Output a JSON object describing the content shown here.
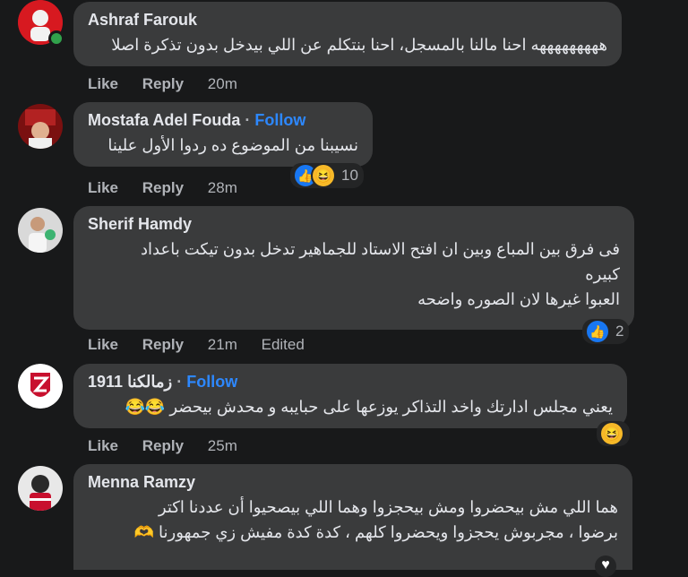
{
  "comments": [
    {
      "name": "Ashraf Farouk",
      "follow": "",
      "text_lines": [
        "هههههههههه احنا مالنا بالمسجل، احنا بنتكلم عن اللي بيدخل بدون تذكرة اصلا"
      ],
      "actions": {
        "like": "Like",
        "reply": "Reply",
        "time": "20m",
        "edited": ""
      },
      "reactions": {
        "count": ""
      }
    },
    {
      "name": "Mostafa Adel Fouda",
      "follow": "Follow",
      "text_lines": [
        "نسيبنا من الموضوع ده ردوا الأول علينا"
      ],
      "actions": {
        "like": "Like",
        "reply": "Reply",
        "time": "28m",
        "edited": ""
      },
      "reactions": {
        "count": "10"
      }
    },
    {
      "name": "Sherif Hamdy",
      "follow": "",
      "text_lines": [
        "فى فرق بين المباع وبين ان افتح الاستاد للجماهير تدخل بدون تيكت باعداد",
        "كبيره",
        "العبوا غيرها لان الصوره واضحه"
      ],
      "actions": {
        "like": "Like",
        "reply": "Reply",
        "time": "21m",
        "edited": "Edited"
      },
      "reactions": {
        "count": "2"
      }
    },
    {
      "name": "زمالكنا 1911",
      "follow": "Follow",
      "text_lines": [
        "يعني مجلس ادارتك واخد التذاكر يوزعها على حبايبه و محدش بيحضر 😂😂"
      ],
      "actions": {
        "like": "Like",
        "reply": "Reply",
        "time": "25m",
        "edited": ""
      },
      "reactions": {
        "count": ""
      }
    },
    {
      "name": "Menna Ramzy",
      "follow": "",
      "text_lines": [
        "هما اللي مش بيحضروا ومش بيحجزوا وهما اللي بيصحيوا أن عددنا اكتر",
        "برضوا ، مجربوش يحجزوا ويحضروا كلهم ، كدة كدة مفيش زي جمهورنا 🫶"
      ],
      "actions": {
        "like": "",
        "reply": "",
        "time": "",
        "edited": ""
      },
      "reactions": {
        "count": ""
      }
    }
  ],
  "colors": {
    "bubble": "#3a3b3c",
    "background": "#18191a",
    "link": "#2d88ff",
    "like": "#1877f2",
    "haha": "#f7b928"
  }
}
